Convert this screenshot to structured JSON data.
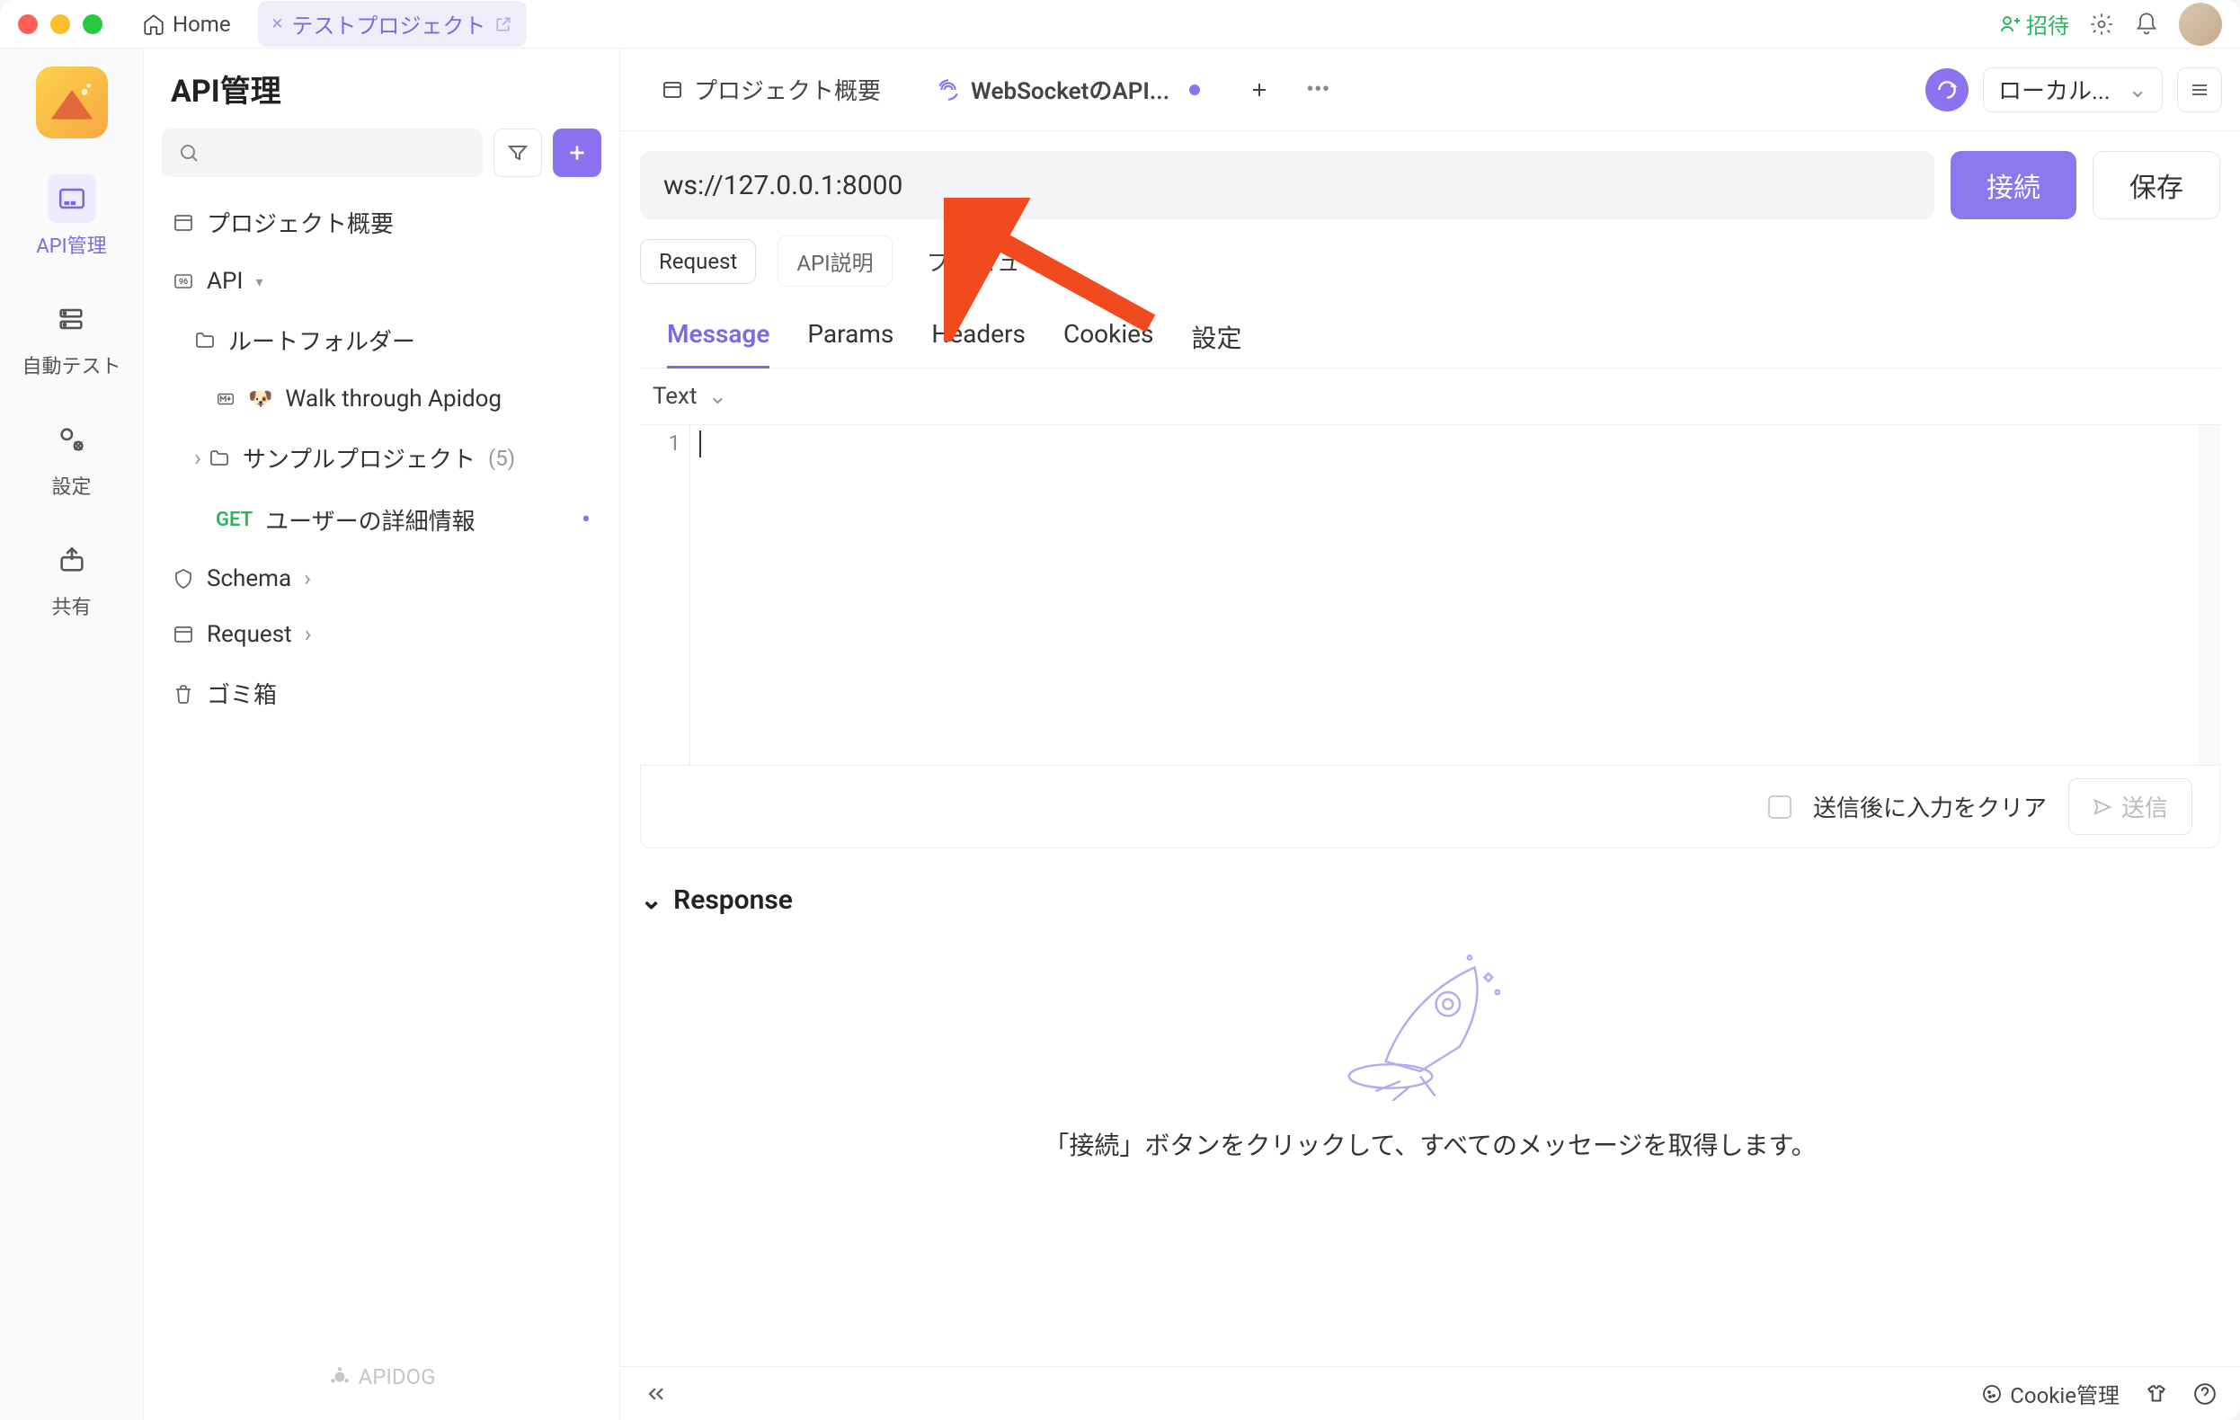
{
  "titlebar": {
    "home": "Home",
    "project_tab": "テストプロジェクト",
    "invite": "招待"
  },
  "rail": {
    "items": [
      {
        "label": "API管理",
        "icon": "api"
      },
      {
        "label": "自動テスト",
        "icon": "auto-test"
      },
      {
        "label": "設定",
        "icon": "settings"
      },
      {
        "label": "共有",
        "icon": "share"
      }
    ]
  },
  "sidebar": {
    "title": "API管理",
    "overview": "プロジェクト概要",
    "api_label": "API",
    "root_folder": "ルートフォルダー",
    "walk_through": "Walk through Apidog",
    "sample_project": "サンプルプロジェクト",
    "sample_count": "(5)",
    "user_detail_method": "GET",
    "user_detail": "ユーザーの詳細情報",
    "schema": "Schema",
    "request": "Request",
    "trash": "ゴミ箱",
    "brand": "APIDOG"
  },
  "tabs": {
    "overview": "プロジェクト概要",
    "websocket": "WebSocketのAPI..."
  },
  "env": {
    "label": "ローカル...",
    "connect": "接続",
    "save": "保存"
  },
  "request": {
    "url": "ws://127.0.0.1:8000",
    "tab_request": "Request",
    "tab_api_desc": "API説明",
    "tab_preview": "プレビュー"
  },
  "section_tabs": [
    "Message",
    "Params",
    "Headers",
    "Cookies",
    "設定"
  ],
  "editor": {
    "text_type": "Text",
    "line1": "1"
  },
  "send_bar": {
    "clear_after": "送信後に入力をクリア",
    "send": "送信"
  },
  "response": {
    "label": "Response",
    "placeholder": "「接続」ボタンをクリックして、すべてのメッセージを取得します。"
  },
  "footer": {
    "cookie": "Cookie管理"
  }
}
